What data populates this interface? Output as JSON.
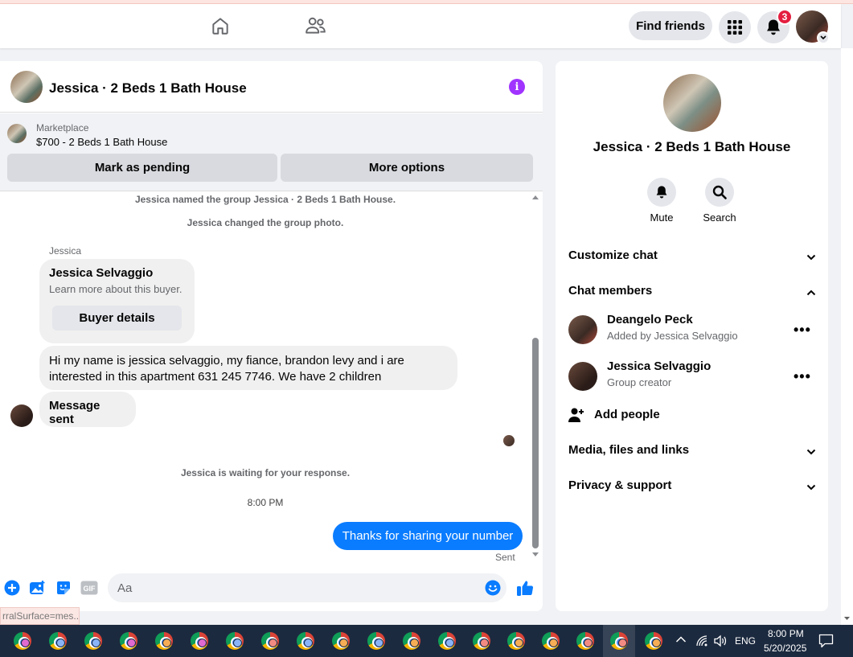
{
  "topbar": {
    "find_friends": "Find friends",
    "notifications_count": "3",
    "icons": [
      "home-icon",
      "friends-icon",
      "apps-grid-icon",
      "bell-icon"
    ]
  },
  "chat": {
    "title": "Jessica · 2 Beds 1 Bath House",
    "marketplace": {
      "label": "Marketplace",
      "item": "$700 - 2 Beds 1 Bath House",
      "mark_pending": "Mark as pending",
      "more_options": "More options"
    },
    "messages": {
      "sys_rename": "Jessica named the group Jessica · 2 Beds 1 Bath House.",
      "sys_photo": "Jessica changed the group photo.",
      "sender": "Jessica",
      "card_title": "Jessica Selvaggio",
      "card_sub": "Learn more about this buyer.",
      "card_button": "Buyer details",
      "text_line1": "Hi my name is jessica selvaggio, my fiance, brandon levy and i are",
      "text_line2": "interested in this apartment 631 245 7746. We have 2 children",
      "message_sent": "Message sent",
      "waiting": "Jessica is waiting for your response.",
      "time": "8:00 PM",
      "outgoing": "Thanks for sharing your number",
      "sent_status": "Sent"
    },
    "composer": {
      "placeholder": "Aa"
    }
  },
  "info": {
    "name": "Jessica · 2 Beds 1 Bath House",
    "actions": {
      "mute": "Mute",
      "search": "Search"
    },
    "customize": "Customize chat",
    "members_header": "Chat members",
    "members": [
      {
        "name": "Deangelo Peck",
        "sub": "Added by Jessica Selvaggio"
      },
      {
        "name": "Jessica Selvaggio",
        "sub": "Group creator"
      }
    ],
    "add_people": "Add people",
    "media": "Media, files and links",
    "privacy": "Privacy & support"
  },
  "status_url": "rralSurface=mes...",
  "taskbar": {
    "lang": "ENG",
    "time": "8:00 PM",
    "date": "5/20/2025"
  },
  "colors": {
    "accent": "#0a7cff",
    "info_purple": "#a033ff",
    "badge_red": "#e41e3f"
  }
}
